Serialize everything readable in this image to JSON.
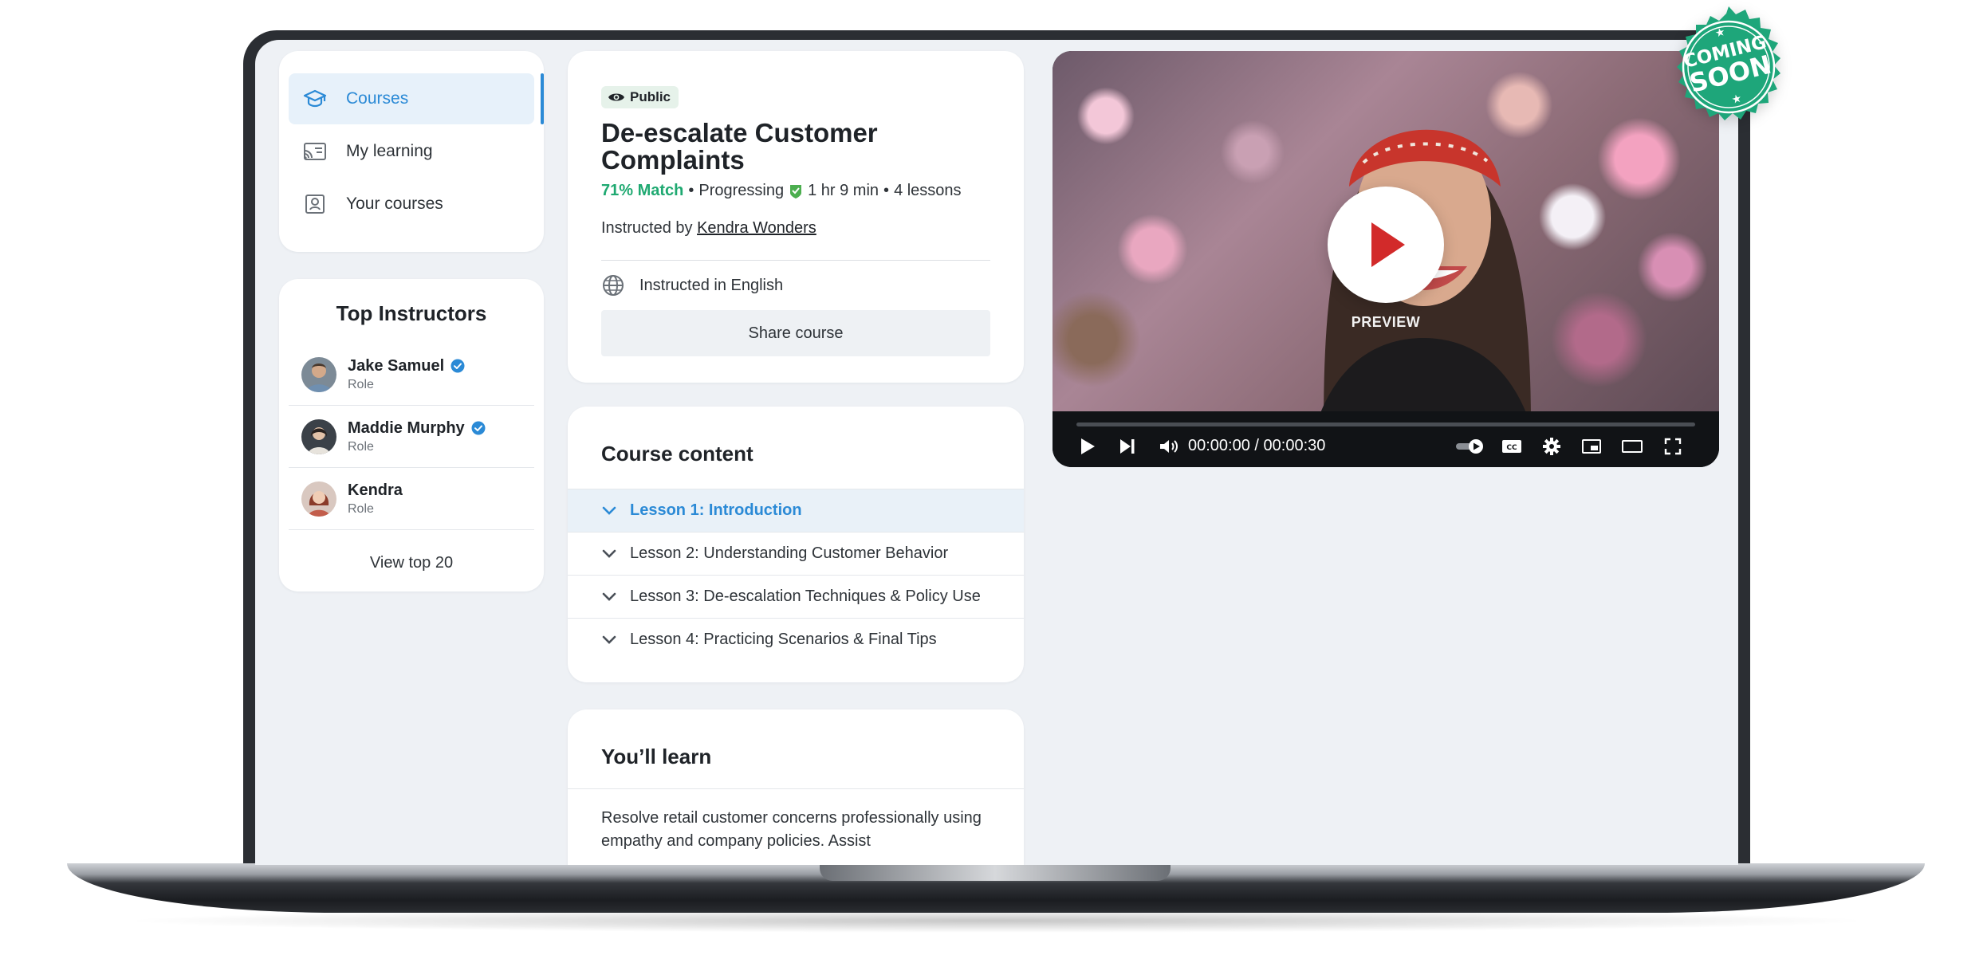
{
  "nav": {
    "items": [
      {
        "label": "Courses",
        "icon": "graduation-cap-icon",
        "active": true
      },
      {
        "label": "My learning",
        "icon": "cast-icon",
        "active": false
      },
      {
        "label": "Your courses",
        "icon": "contact-card-icon",
        "active": false
      }
    ]
  },
  "instructors": {
    "title": "Top Instructors",
    "list": [
      {
        "name": "Jake Samuel",
        "role": "Role",
        "verified": true
      },
      {
        "name": "Maddie Murphy",
        "role": "Role",
        "verified": true
      },
      {
        "name": "Kendra",
        "role": "Role",
        "verified": false
      }
    ],
    "view_all": "View top 20"
  },
  "course": {
    "visibility": "Public",
    "title": "De-escalate Customer Complaints",
    "match": "71% Match",
    "status": "Progressing",
    "duration": "1 hr 9 min",
    "lessons_count": "4 lessons",
    "instructed_by_prefix": "Instructed by",
    "instructor": "Kendra Wonders",
    "language": "Instructed in English",
    "share": "Share course"
  },
  "content": {
    "title": "Course content",
    "lessons": [
      {
        "label": "Lesson 1: Introduction",
        "active": true
      },
      {
        "label": "Lesson 2: Understanding Customer Behavior",
        "active": false
      },
      {
        "label": "Lesson 3: De-escalation Techniques & Policy Use",
        "active": false
      },
      {
        "label": "Lesson 4: Practicing Scenarios & Final Tips",
        "active": false
      }
    ]
  },
  "learn": {
    "title": "You’ll learn",
    "text": "Resolve retail customer concerns professionally using empathy and company policies. Assist"
  },
  "player": {
    "preview_label": "PREVIEW",
    "time": "00:00:00 / 00:00:30",
    "progress": 0
  },
  "badge": {
    "line1": "COMING",
    "line2": "SOON",
    "color": "#1ea67a"
  },
  "colors": {
    "accent": "#2b8ad6",
    "match_green": "#1fa971",
    "background": "#eef1f5"
  }
}
